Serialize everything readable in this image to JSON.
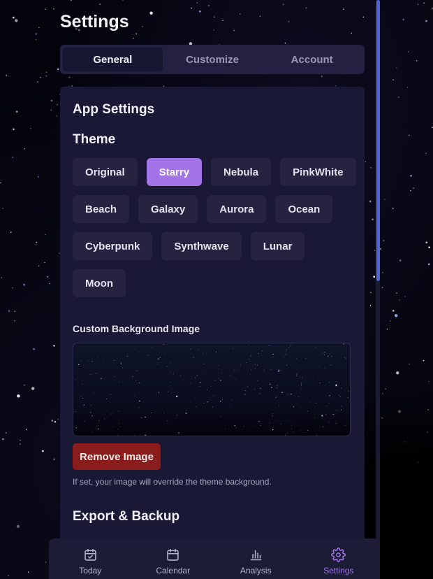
{
  "page": {
    "title": "Settings"
  },
  "tabs": [
    {
      "label": "General",
      "active": true
    },
    {
      "label": "Customize",
      "active": false
    },
    {
      "label": "Account",
      "active": false
    }
  ],
  "app_settings": {
    "heading": "App Settings",
    "theme_heading": "Theme",
    "themes": [
      {
        "label": "Original",
        "active": false
      },
      {
        "label": "Starry",
        "active": true
      },
      {
        "label": "Nebula",
        "active": false
      },
      {
        "label": "PinkWhite",
        "active": false
      },
      {
        "label": "Beach",
        "active": false
      },
      {
        "label": "Galaxy",
        "active": false
      },
      {
        "label": "Aurora",
        "active": false
      },
      {
        "label": "Ocean",
        "active": false
      },
      {
        "label": "Cyberpunk",
        "active": false
      },
      {
        "label": "Synthwave",
        "active": false
      },
      {
        "label": "Lunar",
        "active": false
      },
      {
        "label": "Moon",
        "active": false
      }
    ],
    "custom_background_label": "Custom Background Image",
    "remove_button_label": "Remove Image",
    "hint": "If set, your image will override the theme background.",
    "export_heading": "Export & Backup"
  },
  "bottom_nav": [
    {
      "label": "Today",
      "icon": "calendar-check-icon",
      "active": false
    },
    {
      "label": "Calendar",
      "icon": "calendar-icon",
      "active": false
    },
    {
      "label": "Analysis",
      "icon": "bar-chart-icon",
      "active": false
    },
    {
      "label": "Settings",
      "icon": "gear-icon",
      "active": true
    }
  ],
  "colors": {
    "accent": "#a274e8",
    "danger": "#8b1c1c",
    "panel": "#191935",
    "scrollbar": "#4d63d8"
  }
}
